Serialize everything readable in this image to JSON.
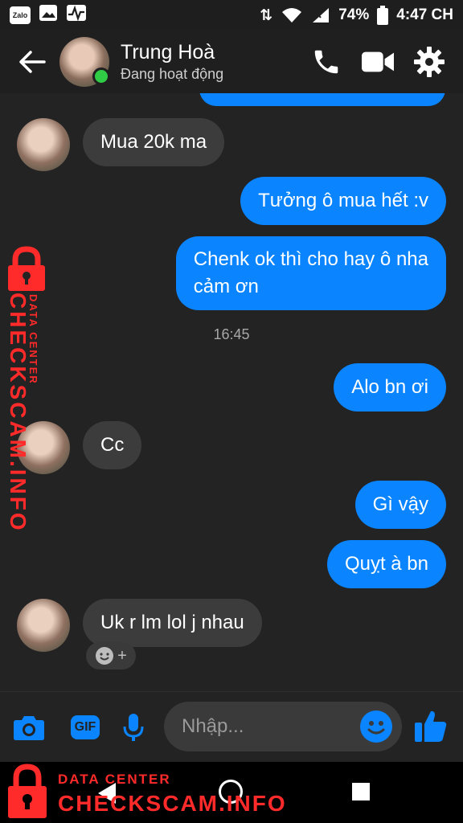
{
  "status_bar": {
    "left_icons": [
      "zalo-icon",
      "gallery-icon",
      "activity-icon"
    ],
    "zalo_label": "Zalo",
    "battery": "74%",
    "time": "4:47 CH"
  },
  "header": {
    "contact_name": "Trung Hoà",
    "status": "Đang hoạt động"
  },
  "messages": [
    {
      "from": "them",
      "text": "Mua 20k ma"
    },
    {
      "from": "me",
      "text": "Tưởng ô mua hết :v"
    },
    {
      "from": "me",
      "text_line1": "Chenk ok thì cho hay ô nha",
      "text_line2": "cảm ơn"
    },
    {
      "timestamp": "16:45"
    },
    {
      "from": "me",
      "text": "Alo bn ơi"
    },
    {
      "from": "them",
      "text": "Cc"
    },
    {
      "from": "me",
      "text": "Gì vậy"
    },
    {
      "from": "me",
      "text": "Quỵt à bn"
    },
    {
      "from": "them",
      "text": "Uk r lm lol j nhau"
    }
  ],
  "composer": {
    "placeholder": "Nhập...",
    "gif_label": "GIF"
  },
  "watermark": {
    "small": "DATA CENTER",
    "big": "CHECKSCAM.INFO"
  },
  "colors": {
    "accent": "#0a84ff",
    "background": "#232323",
    "incoming_bubble": "#3c3c3c",
    "online": "#31cc46",
    "watermark": "#ff2a2a"
  }
}
